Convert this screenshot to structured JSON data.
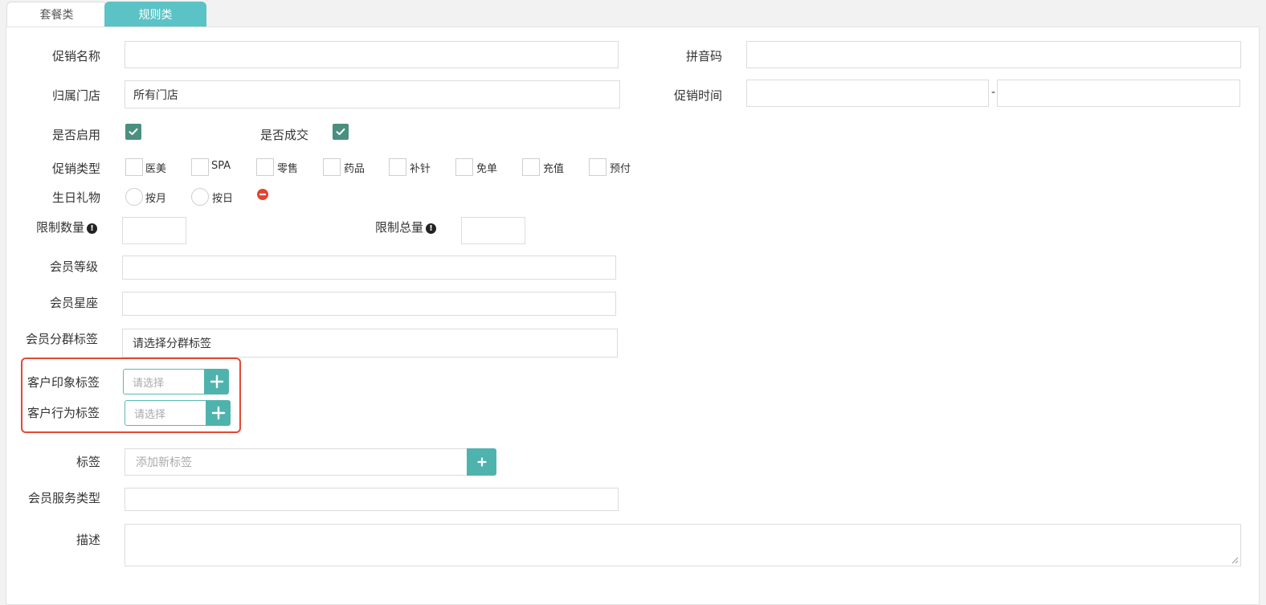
{
  "tabs": [
    {
      "label": "套餐类",
      "active": false
    },
    {
      "label": "规则类",
      "active": true
    }
  ],
  "form": {
    "promo_name_label": "促销名称",
    "pinyin_label": "拼音码",
    "store_label": "归属门店",
    "store_value": "所有门店",
    "promo_time_label": "促销时间",
    "promo_time_separator": "-",
    "enabled_label": "是否启用",
    "enabled_checked": true,
    "deal_label": "是否成交",
    "deal_checked": true,
    "promo_type_label": "促销类型",
    "promo_types": [
      "医美",
      "SPA",
      "零售",
      "药品",
      "补针",
      "免单",
      "充值",
      "预付"
    ],
    "birthday_label": "生日礼物",
    "birthday_options": [
      "按月",
      "按日"
    ],
    "limit_qty_label": "限制数量",
    "limit_total_label": "限制总量",
    "member_level_label": "会员等级",
    "member_zodiac_label": "会员星座",
    "member_group_label": "会员分群标签",
    "member_group_value": "请选择分群标签",
    "impression_tag_label": "客户印象标签",
    "impression_tag_placeholder": "请选择",
    "behavior_tag_label": "客户行为标签",
    "behavior_tag_placeholder": "请选择",
    "tag_label": "标签",
    "tag_placeholder": "添加新标签",
    "service_type_label": "会员服务类型",
    "desc_label": "描述"
  },
  "colors": {
    "accent": "#5bc3c6",
    "checkbox": "#4a8f80",
    "button": "#4fb3ad",
    "highlight": "#e04a35",
    "remove_icon": "#e8412f"
  }
}
